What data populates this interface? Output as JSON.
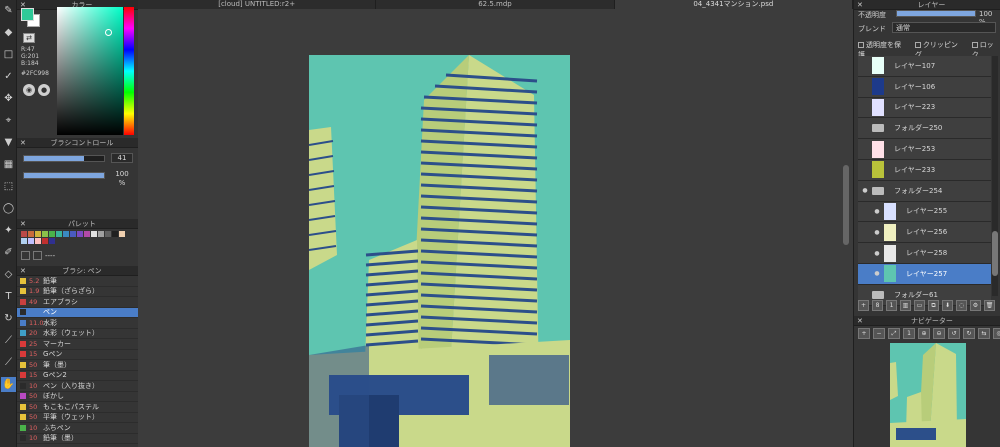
{
  "tabs": [
    "[cloud] UNTITLED:r2+",
    "62.5.mdp",
    "04_4341マンション.psd"
  ],
  "color": {
    "title": "カラー",
    "fg": "#2FC998",
    "r": "R:47",
    "g": "G:201",
    "b": "B:184",
    "hex": "#2FC998"
  },
  "brush_control": {
    "title": "ブラシコントロール",
    "size": "41",
    "opacity": "100 %",
    "size_fraction": 0.75,
    "opacity_fraction": 1.0
  },
  "palette": {
    "title": "パレット",
    "colors": [
      "#b94a48",
      "#c96b3c",
      "#d1b33b",
      "#8bbf4a",
      "#4ab34a",
      "#3ab39a",
      "#3a8ac2",
      "#4a5bc2",
      "#7a4ac2",
      "#b24aa8",
      "#e0e0e0",
      "#a0a0a0",
      "#606060",
      "#202020",
      "#f0d0b0",
      "#b0d0f0",
      "#c0c0ff",
      "#ffc0c0",
      "#c03030",
      "#303090"
    ],
    "dash": "----"
  },
  "brush_list": {
    "title": "ブラシ: ペン",
    "items": [
      {
        "size": "5.2",
        "name": "鉛筆",
        "color": "#e6c23b"
      },
      {
        "size": "1.9",
        "name": "鉛筆（ざらざら）",
        "color": "#e6c23b"
      },
      {
        "size": "49",
        "name": "エアブラシ",
        "color": "#c94040"
      },
      {
        "size": "",
        "name": "ペン",
        "color": "#2b2b2b"
      },
      {
        "size": "11.0",
        "name": "水彩",
        "color": "#4a7dc7"
      },
      {
        "size": "20",
        "name": "水彩（ウェット）",
        "color": "#3fa0c7"
      },
      {
        "size": "25",
        "name": "マーカー",
        "color": "#d93a3a"
      },
      {
        "size": "15",
        "name": "Gペン",
        "color": "#d93a3a"
      },
      {
        "size": "50",
        "name": "筆（墨）",
        "color": "#e6c23b"
      },
      {
        "size": "15",
        "name": "Gペン2",
        "color": "#d93a3a"
      },
      {
        "size": "10",
        "name": "ペン（入り抜き）",
        "color": "#2b2b2b"
      },
      {
        "size": "50",
        "name": "ぼかし",
        "color": "#b94ac2"
      },
      {
        "size": "50",
        "name": "もこもこパステル",
        "color": "#e6c23b"
      },
      {
        "size": "50",
        "name": "平筆（ウェット）",
        "color": "#e6c23b"
      },
      {
        "size": "10",
        "name": "ふちペン",
        "color": "#4ab34a"
      },
      {
        "size": "10",
        "name": "鉛筆（墨）",
        "color": "#2b2b2b"
      }
    ]
  },
  "layer_panel": {
    "title": "レイヤー",
    "opacity_label": "不透明度",
    "opacity_value": "100 %",
    "blend_label": "ブレンド",
    "blend_value": "通常",
    "protect_label": "透明度を保護",
    "clip_label": "クリッピング",
    "lock_label": "ロック",
    "layers": [
      {
        "name": "レイヤー107",
        "kind": "layer",
        "thumb": "#e8fff8",
        "indent": false,
        "eye": false,
        "selected": false
      },
      {
        "name": "レイヤー106",
        "kind": "layer",
        "thumb": "#1d3a8a",
        "indent": false,
        "eye": false,
        "selected": false
      },
      {
        "name": "レイヤー223",
        "kind": "layer",
        "thumb": "#e0e0ff",
        "indent": false,
        "eye": false,
        "selected": false
      },
      {
        "name": "フォルダー250",
        "kind": "folder",
        "thumb": "",
        "indent": false,
        "eye": false,
        "selected": false
      },
      {
        "name": "レイヤー253",
        "kind": "layer",
        "thumb": "#ffe0e8",
        "indent": false,
        "eye": false,
        "selected": false
      },
      {
        "name": "レイヤー233",
        "kind": "layer",
        "thumb": "#b9c23a",
        "indent": false,
        "eye": false,
        "selected": false
      },
      {
        "name": "フォルダー254",
        "kind": "folder",
        "thumb": "",
        "indent": false,
        "eye": true,
        "selected": false
      },
      {
        "name": "レイヤー255",
        "kind": "layer",
        "thumb": "#d8e0ff",
        "indent": true,
        "eye": true,
        "selected": false
      },
      {
        "name": "レイヤー256",
        "kind": "layer",
        "thumb": "#f0f0c0",
        "indent": true,
        "eye": true,
        "selected": false
      },
      {
        "name": "レイヤー258",
        "kind": "layer",
        "thumb": "#e8e8e8",
        "indent": true,
        "eye": true,
        "selected": false
      },
      {
        "name": "レイヤー257",
        "kind": "layer",
        "thumb": "#5ec5b0",
        "indent": true,
        "eye": true,
        "selected": true
      },
      {
        "name": "フォルダー61",
        "kind": "folder",
        "thumb": "",
        "indent": false,
        "eye": false,
        "selected": false
      }
    ]
  },
  "navigator": {
    "title": "ナビゲーター"
  },
  "canvas": {
    "sky": "#5ec5b0",
    "light": "#c9d98a",
    "dark": "#2c4f8a"
  }
}
